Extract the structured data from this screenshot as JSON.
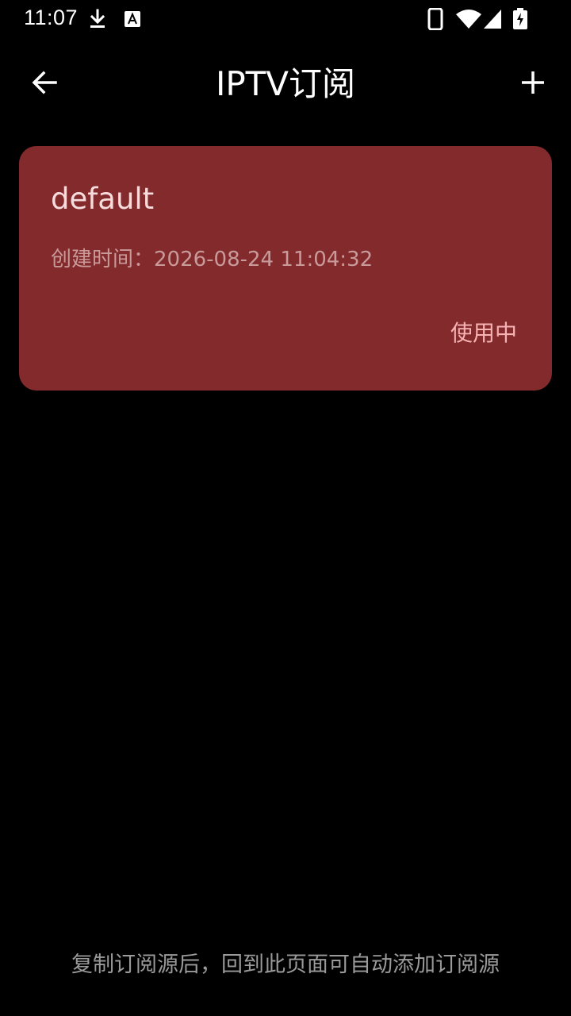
{
  "status_bar": {
    "time": "11:07",
    "icons": [
      "download-icon",
      "font-notification-icon",
      "phone-icon",
      "wifi-icon",
      "signal-icon",
      "battery-charging-icon"
    ]
  },
  "app_bar": {
    "title": "IPTV订阅",
    "back_icon": "arrow-back-icon",
    "add_icon": "plus-icon"
  },
  "subscriptions": [
    {
      "name": "default",
      "created": "创建时间：2026-08-24 11:04:32",
      "status": "使用中"
    }
  ],
  "footer": {
    "hint": "复制订阅源后，回到此页面可自动添加订阅源"
  },
  "colors": {
    "background": "#000000",
    "card": "#832a2d",
    "card_status": "#f7b3b3",
    "hint": "#9a9a9a"
  }
}
